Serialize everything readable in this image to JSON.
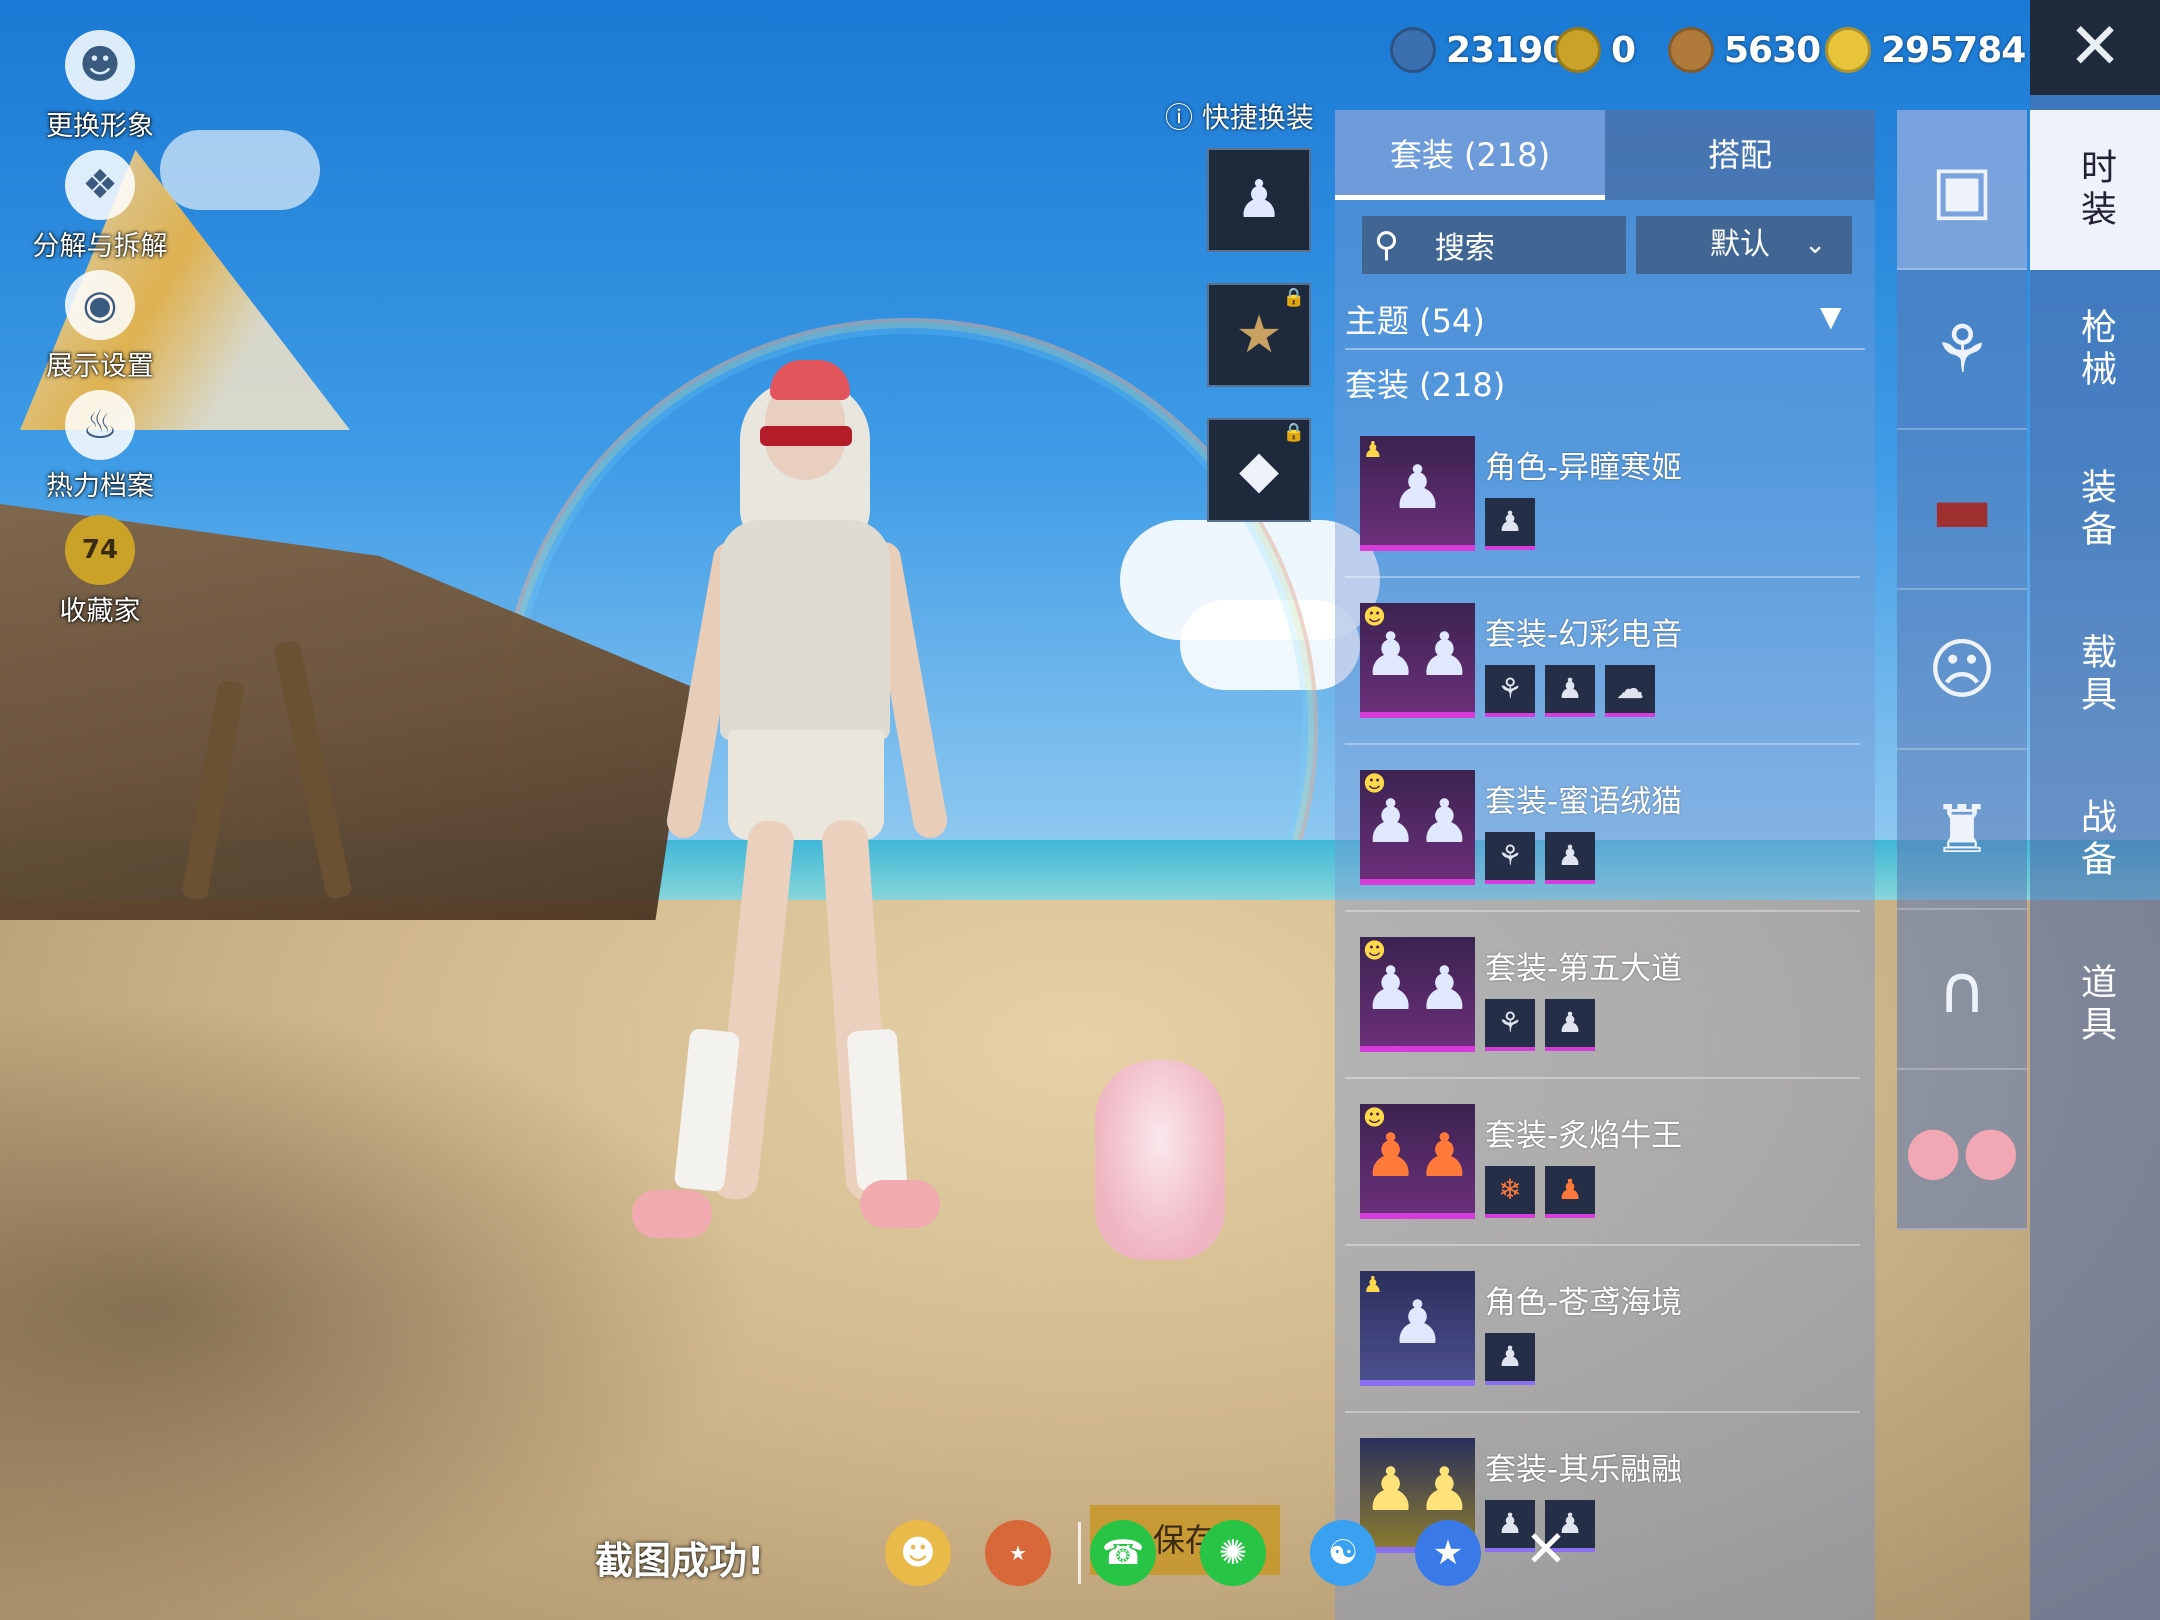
{
  "left_menu": [
    {
      "label": "更换形象",
      "icon": "avatar-icon"
    },
    {
      "label": "分解与拆解",
      "icon": "puzzle-icon"
    },
    {
      "label": "展示设置",
      "icon": "eye-icon"
    },
    {
      "label": "热力档案",
      "icon": "flame-icon"
    },
    {
      "label": "收藏家",
      "icon": "collector-badge-icon",
      "badge": "74"
    }
  ],
  "currencies": [
    {
      "value": "23190",
      "color": "#3a6fb0"
    },
    {
      "value": "0",
      "color": "#c9a227"
    },
    {
      "value": "5630",
      "color": "#b07a3a"
    },
    {
      "value": "295784",
      "color": "#e8c43a"
    }
  ],
  "quick_change": {
    "title": "快捷换装"
  },
  "tabs": [
    {
      "label": "套装 (218)",
      "active": true
    },
    {
      "label": "搭配",
      "active": false
    }
  ],
  "search": {
    "placeholder": "搜索"
  },
  "sort": {
    "label": "默认"
  },
  "filters": {
    "theme": "主题 (54)",
    "suit": "套装 (218)"
  },
  "items": [
    {
      "title": "角色-异瞳寒姬",
      "rarity": "purple",
      "badge": "character",
      "parts": 1
    },
    {
      "title": "套装-幻彩电音",
      "rarity": "purple",
      "badge": "smile",
      "parts": 3
    },
    {
      "title": "套装-蜜语绒猫",
      "rarity": "purple",
      "badge": "smile",
      "parts": 2
    },
    {
      "title": "套装-第五大道",
      "rarity": "purple",
      "badge": "smile",
      "parts": 2
    },
    {
      "title": "套装-炙焰牛王",
      "rarity": "purple",
      "badge": "smile",
      "parts": 2
    },
    {
      "title": "角色-苍鸢海境",
      "rarity": "blue",
      "badge": "character",
      "parts": 1
    },
    {
      "title": "套装-其乐融融",
      "rarity": "blue",
      "badge": "smile",
      "parts": 2
    }
  ],
  "category_icons": [
    "suit-box-icon",
    "hair-icon",
    "hat-icon",
    "mask-icon",
    "jacket-icon",
    "pants-icon",
    "slippers-icon"
  ],
  "vertical_nav": [
    {
      "label": "时装",
      "active": true
    },
    {
      "label": "枪械",
      "active": false
    },
    {
      "label": "装备",
      "active": false
    },
    {
      "label": "载具",
      "active": false
    },
    {
      "label": "战备",
      "active": false
    },
    {
      "label": "道具",
      "active": false
    }
  ],
  "bottom": {
    "toast": "截图成功!",
    "save_label": "保存"
  }
}
